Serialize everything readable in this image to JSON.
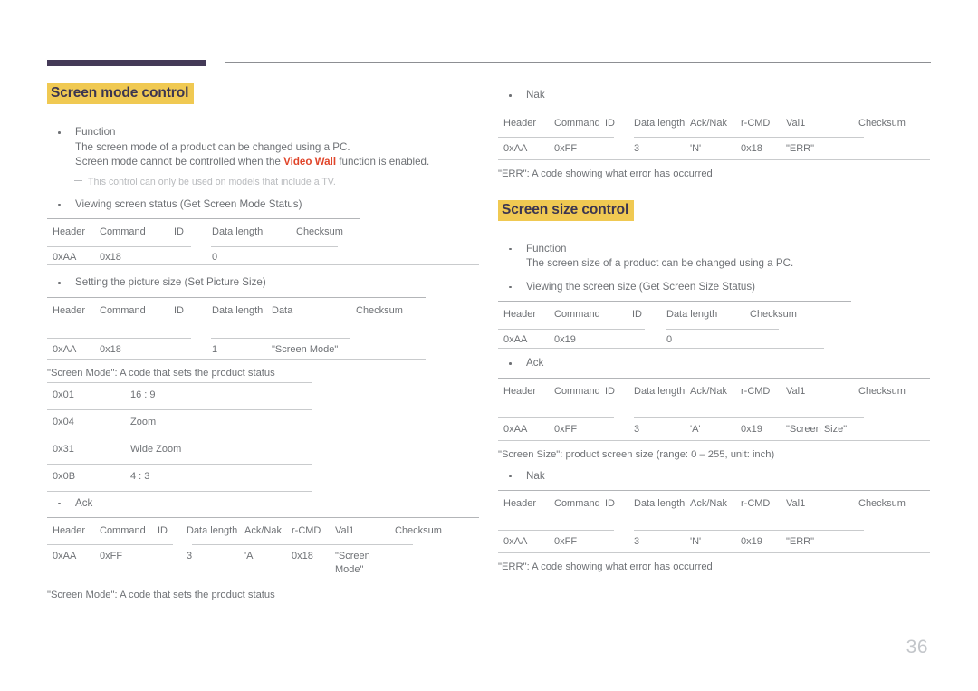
{
  "page": {
    "number": "36"
  },
  "left_column": {
    "section_title": "Screen mode control",
    "function_bullet": {
      "label": "Function",
      "line1": "The screen mode of a product can be changed using a PC.",
      "line2_pre": "Screen mode cannot be controlled when the ",
      "line2_hl": "Video Wall",
      "line2_post": " function is enabled."
    },
    "note": "This control can only be used on models that include a TV.",
    "get_status": {
      "bullet": "Viewing screen status (Get Screen Mode Status)",
      "headers": [
        "Header",
        "Command",
        "ID",
        "Data length",
        "Checksum"
      ],
      "values": [
        "0xAA",
        "0x18",
        "",
        "0",
        ""
      ]
    },
    "set_picture_size": {
      "bullet": "Setting the picture size (Set Picture Size)",
      "headers": [
        "Header",
        "Command",
        "ID",
        "Data length",
        "Data",
        "Checksum"
      ],
      "values": [
        "0xAA",
        "0x18",
        "",
        "1",
        "\"Screen Mode\"",
        ""
      ]
    },
    "screen_mode_caption": "\"Screen Mode\": A code that sets the product status",
    "screen_mode_codes": [
      {
        "code": "0x01",
        "name": "16 : 9"
      },
      {
        "code": "0x04",
        "name": "Zoom"
      },
      {
        "code": "0x31",
        "name": "Wide Zoom"
      },
      {
        "code": "0x0B",
        "name": "4 : 3"
      }
    ],
    "ack": {
      "bullet": "Ack",
      "headers": [
        "Header",
        "Command",
        "ID",
        "Data length",
        "Ack/Nak",
        "r-CMD",
        "Val1",
        "Checksum"
      ],
      "values": [
        "0xAA",
        "0xFF",
        "",
        "3",
        "'A'",
        "0x18",
        "\"Screen Mode\"",
        ""
      ]
    },
    "ack_caption": "\"Screen Mode\": A code that sets the product status"
  },
  "right_column": {
    "nak_top": {
      "bullet": "Nak",
      "headers": [
        "Header",
        "Command",
        "ID",
        "Data length",
        "Ack/Nak",
        "r-CMD",
        "Val1",
        "Checksum"
      ],
      "values": [
        "0xAA",
        "0xFF",
        "",
        "3",
        "'N'",
        "0x18",
        "\"ERR\"",
        ""
      ]
    },
    "nak_top_caption": "\"ERR\": A code showing what error has occurred",
    "section_title": "Screen size control",
    "function_bullet": {
      "label": "Function",
      "line1": "The screen size of a product can be changed using a PC."
    },
    "get_status": {
      "bullet": "Viewing the screen size (Get Screen Size Status)",
      "headers": [
        "Header",
        "Command",
        "ID",
        "Data length",
        "Checksum"
      ],
      "values": [
        "0xAA",
        "0x19",
        "",
        "0",
        ""
      ]
    },
    "ack": {
      "bullet": "Ack",
      "headers": [
        "Header",
        "Command",
        "ID",
        "Data length",
        "Ack/Nak",
        "r-CMD",
        "Val1",
        "Checksum"
      ],
      "values": [
        "0xAA",
        "0xFF",
        "",
        "3",
        "'A'",
        "0x19",
        "\"Screen Size\"",
        ""
      ]
    },
    "ack_caption": "\"Screen Size\": product screen size (range: 0 – 255, unit: inch)",
    "nak_bottom": {
      "bullet": "Nak",
      "headers": [
        "Header",
        "Command",
        "ID",
        "Data length",
        "Ack/Nak",
        "r-CMD",
        "Val1",
        "Checksum"
      ],
      "values": [
        "0xAA",
        "0xFF",
        "",
        "3",
        "'N'",
        "0x19",
        "\"ERR\"",
        ""
      ]
    },
    "nak_bottom_caption": "\"ERR\": A code showing what error has occurred"
  },
  "colors": {
    "header_bar": "#443a57",
    "heading_highlight": "#f0c952",
    "heading_text": "#3b3550",
    "accent_red": "#e0452a",
    "body_text": "#6e7175",
    "rule": "#c9cbcd"
  }
}
